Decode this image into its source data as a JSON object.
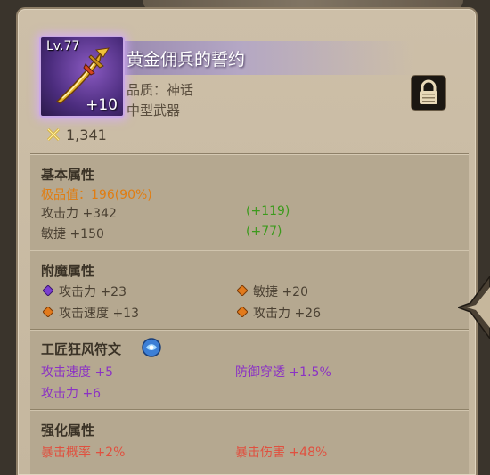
{
  "item": {
    "level_label": "Lv.77",
    "enhance": "+10",
    "name": "黄金佣兵的誓约",
    "quality": "品质：神话",
    "type": "中型武器",
    "gear_score": "1,341"
  },
  "basic": {
    "title": "基本属性",
    "rating_label": "极品值：196(90%)",
    "stats": [
      {
        "label": "攻击力 +342",
        "bonus": "(+119)"
      },
      {
        "label": "敏捷 +150",
        "bonus": "(+77)"
      }
    ]
  },
  "enchant": {
    "title": "附魔属性",
    "stats": [
      {
        "label": "攻击力 +23",
        "gem": "purple-gem-icon"
      },
      {
        "label": "敏捷 +20",
        "gem": "orange-gem-icon"
      },
      {
        "label": "攻击速度 +13",
        "gem": "orange-gem-icon"
      },
      {
        "label": "攻击力 +26",
        "gem": "orange-gem-icon"
      }
    ]
  },
  "rune": {
    "title": "工匠狂风符文",
    "stats": [
      "攻击速度 +5",
      "防御穿透 +1.5%",
      "攻击力 +6"
    ]
  },
  "upgrade": {
    "title": "强化属性",
    "stats": [
      "暴击概率 +2%",
      "暴击伤害 +48%"
    ]
  },
  "colors": {
    "bonus_green": "#3c9a1c",
    "rating_orange": "#e07d12",
    "rune_purple": "#8b32c4",
    "upgrade_red": "#e0503f"
  }
}
